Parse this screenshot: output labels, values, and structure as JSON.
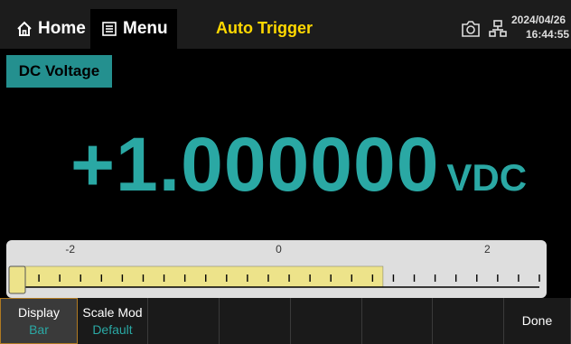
{
  "topbar": {
    "home_label": "Home",
    "menu_label": "Menu",
    "title": "Auto Trigger",
    "date": "2024/04/26",
    "time": "16:44:55"
  },
  "function_label": "DC Voltage",
  "reading": {
    "value": "+1.000000",
    "unit": "VDC"
  },
  "bar_graph": {
    "scale_labels": [
      "-2",
      "0",
      "2"
    ],
    "range_min": -2.5,
    "range_max": 2.5,
    "current_value": 1.0,
    "fill_color": "#ede38a"
  },
  "softkeys": [
    {
      "label": "Display",
      "sub": "Bar"
    },
    {
      "label": "Scale Mod",
      "sub": "Default"
    },
    {
      "label": "",
      "sub": ""
    },
    {
      "label": "",
      "sub": ""
    },
    {
      "label": "",
      "sub": ""
    },
    {
      "label": "",
      "sub": ""
    },
    {
      "label": "",
      "sub": ""
    },
    {
      "label": "Done",
      "sub": ""
    }
  ],
  "colors": {
    "accent": "#2aa8a4",
    "title": "#ffd800",
    "active_border": "#b07a22"
  },
  "icons": [
    "home-icon",
    "menu-icon",
    "camera-icon",
    "network-icon"
  ]
}
